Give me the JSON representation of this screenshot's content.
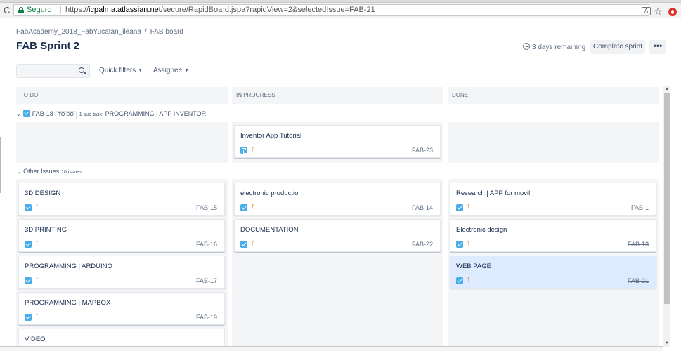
{
  "browser": {
    "secure_label": "Seguro",
    "url_prefix": "https://",
    "url_domain": "icpalma.atlassian.net",
    "url_path": "/secure/RapidBoard.jspa?rapidView=2&selectedIssue=FAB-21",
    "translate_glyph": "A",
    "star_glyph": "☆",
    "reload_glyph": "C"
  },
  "header": {
    "breadcrumb_project": "FabAcademy_2018_FabYucatan_ileana",
    "breadcrumb_sep": "/",
    "breadcrumb_board": "FAB board",
    "title": "FAB Sprint 2",
    "remaining": "3 days remaining",
    "complete_sprint": "Complete sprint",
    "more": "•••"
  },
  "filters": {
    "search_placeholder": "",
    "quick_filters": "Quick filters",
    "assignee": "Assignee",
    "chevron": "▼"
  },
  "columns": [
    "TO DO",
    "IN PROGRESS",
    "DONE"
  ],
  "swimlane": {
    "chevron": "⌄",
    "key": "FAB-18",
    "status": "TO DO",
    "subtasks": "1 sub-task",
    "title": "PROGRAMMING | APP INVENTOR",
    "card": {
      "title": "Inventor App Tutorial",
      "key": "FAB-23"
    }
  },
  "other_issues": {
    "label": "Other Issues",
    "count": "10 issues"
  },
  "priority_glyph": "↑",
  "cards": {
    "todo": [
      {
        "title": "3D DESIGN",
        "key": "FAB-15"
      },
      {
        "title": "3D PRINTING",
        "key": "FAB-16"
      },
      {
        "title": "PROGRAMMING | ARDUINO",
        "key": "FAB-17"
      },
      {
        "title": "PROGRAMMING | MAPBOX",
        "key": "FAB-19"
      },
      {
        "title": "VIDEO",
        "key": ""
      }
    ],
    "in_progress": [
      {
        "title": "electronic production",
        "key": "FAB-14"
      },
      {
        "title": "DOCUMENTATION",
        "key": "FAB-22"
      }
    ],
    "done": [
      {
        "title": "Research | APP for movil",
        "key": "FAB-1"
      },
      {
        "title": "Electronic design",
        "key": "FAB-13"
      },
      {
        "title": "WEB PAGE",
        "key": "FAB-21"
      }
    ]
  },
  "scroll": {
    "up": "▲",
    "down": "▼"
  }
}
